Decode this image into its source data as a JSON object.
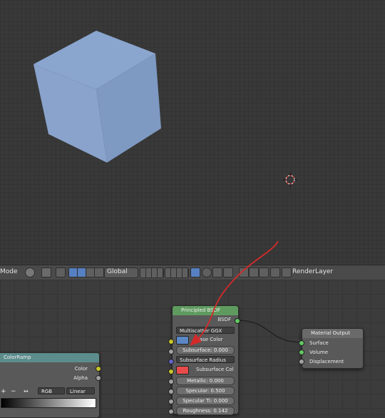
{
  "viewport": {
    "label": "3D Viewport"
  },
  "header": {
    "mode": "Mode",
    "pivot": "Global",
    "render_layer": "RenderLayer"
  },
  "principled": {
    "title": "Principled BSDF",
    "output": "BSDF",
    "distribution": "Multiscatter GGX",
    "base_color_label": "Base Color",
    "base_color": "#5b87c5",
    "subsurface": "Subsurface:",
    "subsurface_val": "0.000",
    "subsurface_method": "Subsurface Radius",
    "subsurface_col": "Subsurface Col",
    "subsurface_col_color": "#e64c4c",
    "metallic": "Metallic:",
    "metallic_val": "0.000",
    "specular": "Specular:",
    "specular_val": "0.500",
    "specular_tint": "Specular Ti:",
    "specular_tint_val": "0.000",
    "roughness": "Roughness:",
    "roughness_val": "0.142"
  },
  "material_output": {
    "title": "Material Output",
    "surface": "Surface",
    "volume": "Volume",
    "displacement": "Displacement"
  },
  "colorramp": {
    "title": "ColorRamp",
    "color": "Color",
    "alpha": "Alpha",
    "plus": "+",
    "minus": "−",
    "arrows": "↔",
    "mode": "RGB",
    "interp": "Linear"
  },
  "colors": {
    "accent": "#5680c2",
    "annotation_arrow": "#d42a2a"
  }
}
